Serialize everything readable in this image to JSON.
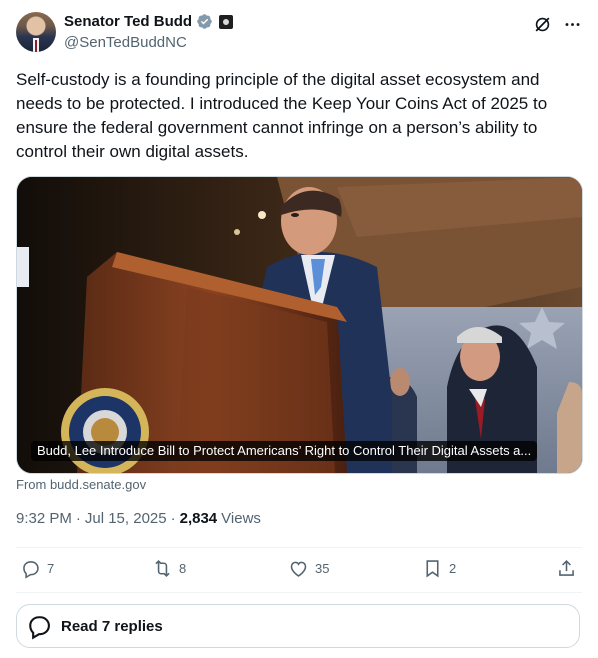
{
  "author": {
    "name": "Senator Ted Budd",
    "handle": "@SenTedBuddNC"
  },
  "tweet": {
    "text": "Self-custody is a founding principle of the digital asset ecosystem and\nneeds to be protected. I introduced the Keep Your Coins Act of 2025 to\nensure the federal government cannot infringe on a person’s ability to\ncontrol their own digital assets."
  },
  "card": {
    "caption": "Budd, Lee Introduce Bill to Protect Americans’ Right to Control Their Digital Assets a...",
    "source": "From budd.senate.gov"
  },
  "meta": {
    "time": "9:32 PM",
    "sep1": "·",
    "date": "Jul 15, 2025",
    "sep2": "·",
    "views_count": "2,834",
    "views_label": "Views"
  },
  "actions": {
    "replies": "7",
    "reposts": "8",
    "likes": "35",
    "bookmarks": "2"
  },
  "read_replies": {
    "label": "Read 7 replies"
  },
  "colors": {
    "verified": "#829aab",
    "text_secondary": "#536471",
    "text_primary": "#0f1419",
    "border": "#cfd9de"
  },
  "icons": [
    "verified-badge-icon",
    "affiliate-badge-icon",
    "grok-icon",
    "more-icon",
    "reply-icon",
    "repost-icon",
    "like-icon",
    "bookmark-icon",
    "share-icon",
    "chat-bubble-icon"
  ]
}
